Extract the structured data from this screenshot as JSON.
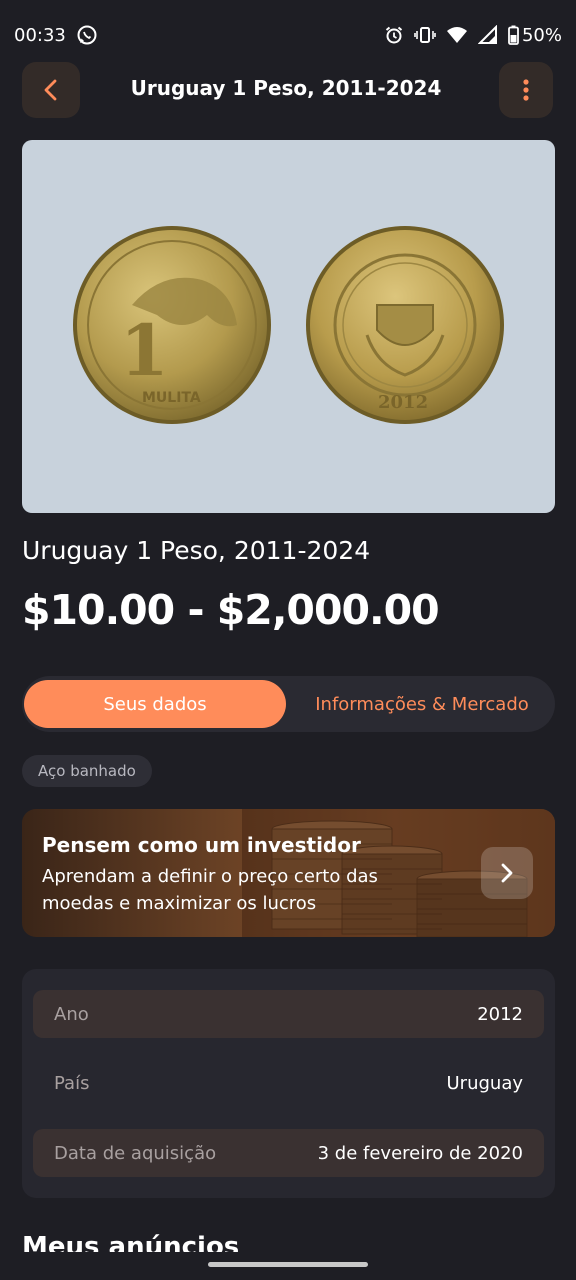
{
  "status": {
    "time": "00:33",
    "battery": "50%"
  },
  "header": {
    "title": "Uruguay 1 Peso, 2011-2024"
  },
  "coin": {
    "name": "Uruguay 1 Peso, 2011-2024",
    "price": "$10.00 - $2,000.00"
  },
  "tabs": [
    {
      "label": "Seus dados"
    },
    {
      "label": "Informações & Mercado"
    }
  ],
  "chip": {
    "label": "Aço banhado"
  },
  "banner": {
    "title": "Pensem como um investidor",
    "text": "Aprendam a definir o preço certo das moedas e maximizar os lucros"
  },
  "details": [
    {
      "label": "Ano",
      "value": "2012"
    },
    {
      "label": "País",
      "value": "Uruguay"
    },
    {
      "label": "Data de aquisição",
      "value": "3 de fevereiro de 2020"
    }
  ],
  "section": {
    "title": "Meus anúncios"
  },
  "colors": {
    "accent": "#ff8c5a",
    "background": "#1e1e24",
    "card": "#27272f"
  }
}
